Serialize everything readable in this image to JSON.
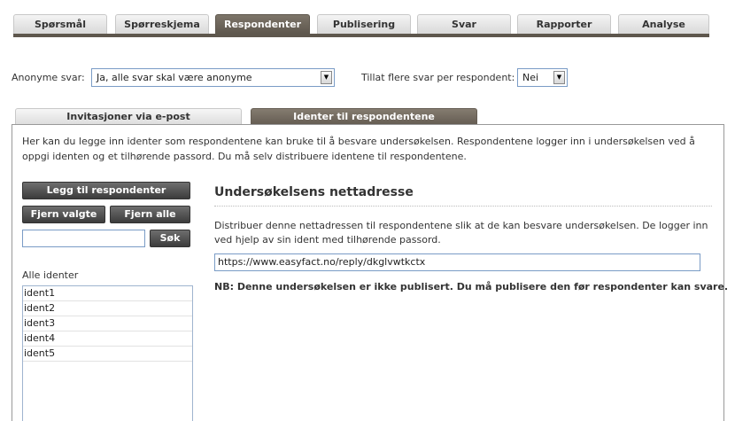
{
  "top_tabs": [
    {
      "label": "Spørsmål"
    },
    {
      "label": "Spørreskjema"
    },
    {
      "label": "Respondenter"
    },
    {
      "label": "Publisering"
    },
    {
      "label": "Svar"
    },
    {
      "label": "Rapporter"
    },
    {
      "label": "Analyse"
    }
  ],
  "active_top_tab": "Respondenter",
  "options": {
    "anon_label": "Anonyme svar:",
    "anon_value": "Ja, alle svar skal være anonyme",
    "multi_label": "Tillat flere svar per respondent:",
    "multi_value": "Nei"
  },
  "sub_tabs": {
    "email": "Invitasjoner via e-post",
    "idents": "Identer til respondentene"
  },
  "panel": {
    "intro": "Her kan du legge inn identer som respondentene kan bruke til å besvare undersøkelsen. Respondentene logger inn i undersøkelsen ved å oppgi identen og et tilhørende passord. Du må selv distribuere identene til respondentene.",
    "buttons": {
      "add": "Legg til respondenter",
      "remove_selected": "Fjern valgte",
      "remove_all": "Fjern alle",
      "search": "Søk"
    },
    "list_label": "Alle identer",
    "idents": [
      "ident1",
      "ident2",
      "ident3",
      "ident4",
      "ident5"
    ],
    "right_title": "Undersøkelsens nettadresse",
    "right_desc": "Distribuer denne nettadressen til respondentene slik at de kan besvare undersøkelsen. De logger inn ved hjelp av sin ident med tilhørende passord.",
    "url": "https://www.easyfact.no/reply/dkglvwtkctx",
    "nb": "NB: Denne undersøkelsen er ikke publisert. Du må publisere den før respondenter kan svare."
  },
  "colors": {
    "active_tab": "#5e574d",
    "button": "#4a4a4a",
    "input_border": "#7a9cc6"
  }
}
